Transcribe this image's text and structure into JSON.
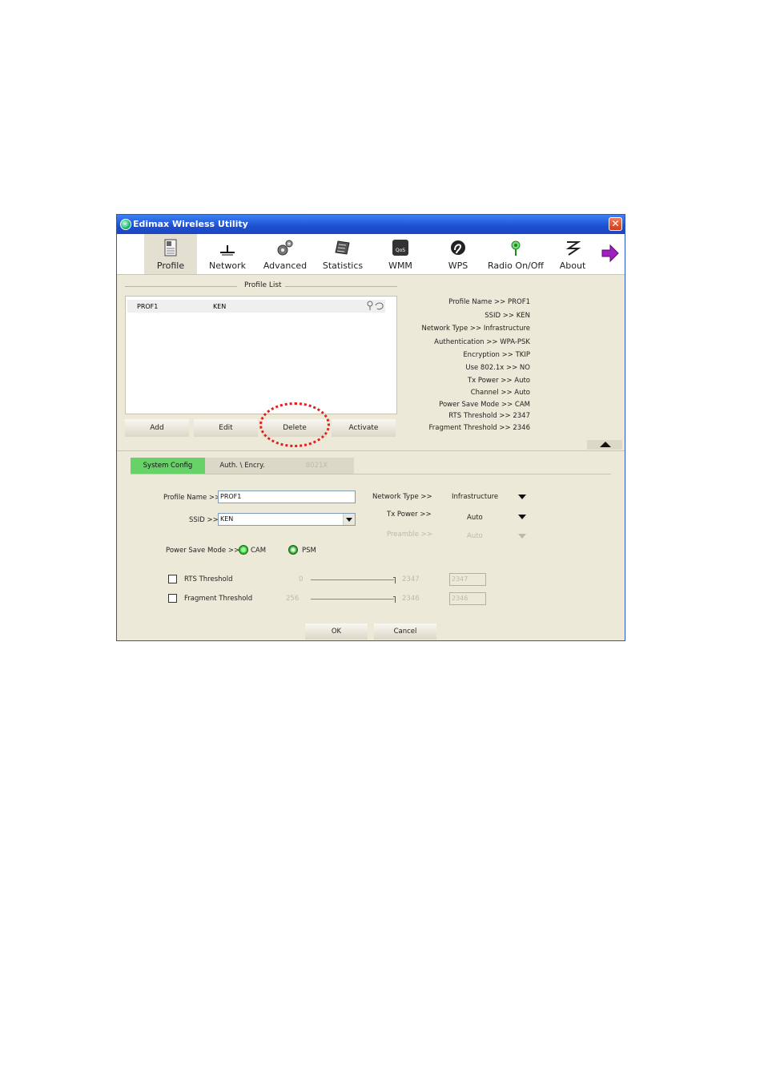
{
  "window": {
    "title": "Edimax Wireless Utility"
  },
  "toolbar": {
    "items": [
      {
        "label": "Profile",
        "icon": "profile-icon"
      },
      {
        "label": "Network",
        "icon": "network-icon"
      },
      {
        "label": "Advanced",
        "icon": "gear-icon"
      },
      {
        "label": "Statistics",
        "icon": "statistics-icon"
      },
      {
        "label": "WMM",
        "icon": "qos-icon",
        "badge": "QoS"
      },
      {
        "label": "WPS",
        "icon": "wps-icon"
      },
      {
        "label": "Radio On/Off",
        "icon": "radio-icon"
      },
      {
        "label": "About",
        "icon": "about-icon"
      }
    ]
  },
  "profile_list": {
    "legend": "Profile List",
    "rows": [
      {
        "name": "PROF1",
        "ssid": "KEN"
      }
    ],
    "buttons": {
      "add": "Add",
      "edit": "Edit",
      "delete": "Delete",
      "activate": "Activate"
    }
  },
  "profile_info": [
    "Profile Name >> PROF1",
    "SSID >> KEN",
    "Network Type >> Infrastructure",
    "Authentication >> WPA-PSK",
    "Encryption >> TKIP",
    "Use 802.1x >> NO",
    "Tx Power >> Auto",
    "Channel >> Auto",
    "Power Save Mode >> CAM",
    "RTS Threshold >> 2347",
    "Fragment Threshold >> 2346"
  ],
  "tabs": {
    "system_config": "System Config",
    "auth": "Auth. \\ Encry.",
    "dot1x": "8021X"
  },
  "config": {
    "profile_name_label": "Profile Name >>",
    "profile_name_value": "PROF1",
    "ssid_label": "SSID >>",
    "ssid_value": "KEN",
    "network_type_label": "Network Type >>",
    "network_type_value": "Infrastructure",
    "tx_power_label": "Tx Power >>",
    "tx_power_value": "Auto",
    "preamble_label": "Preamble >>",
    "preamble_value": "Auto",
    "power_save_label": "Power Save Mode >>",
    "cam_label": "CAM",
    "psm_label": "PSM",
    "rts_label": "RTS Threshold",
    "rts_min": "0",
    "rts_max": "2347",
    "rts_value": "2347",
    "frag_label": "Fragment Threshold",
    "frag_min": "256",
    "frag_max": "2346",
    "frag_value": "2346"
  },
  "footer": {
    "ok": "OK",
    "cancel": "Cancel"
  }
}
